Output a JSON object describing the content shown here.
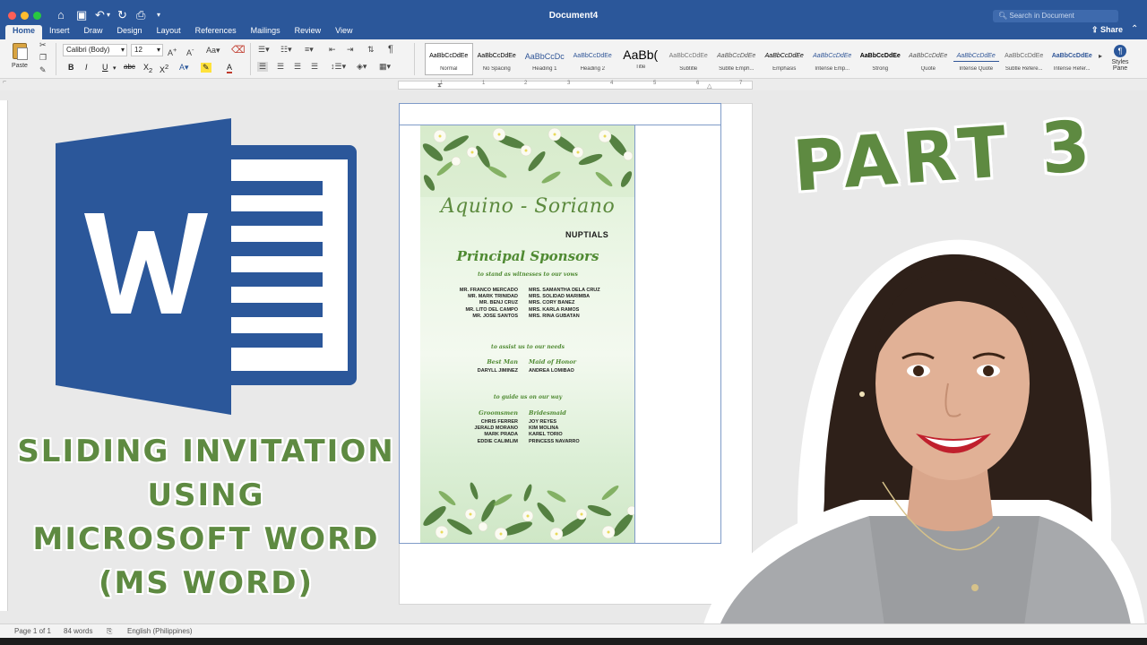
{
  "window": {
    "title": "Document4",
    "search_placeholder": "Search in Document",
    "share_label": "Share"
  },
  "tabs": [
    "Home",
    "Insert",
    "Draw",
    "Design",
    "Layout",
    "References",
    "Mailings",
    "Review",
    "View"
  ],
  "ribbon": {
    "paste_label": "Paste",
    "font_name": "Calibri (Body)",
    "font_size": "12",
    "styles": [
      {
        "sample": "AaBbCcDdEe",
        "label": "Normal"
      },
      {
        "sample": "AaBbCcDdEe",
        "label": "No Spacing"
      },
      {
        "sample": "AaBbCcDc",
        "label": "Heading 1"
      },
      {
        "sample": "AaBbCcDdEe",
        "label": "Heading 2"
      },
      {
        "sample": "AaBb(",
        "label": "Title"
      },
      {
        "sample": "AaBbCcDdEe",
        "label": "Subtitle"
      },
      {
        "sample": "AaBbCcDdEe",
        "label": "Subtle Emph..."
      },
      {
        "sample": "AaBbCcDdEe",
        "label": "Emphasis"
      },
      {
        "sample": "AaBbCcDdEe",
        "label": "Intense Emp..."
      },
      {
        "sample": "AaBbCcDdEe",
        "label": "Strong"
      },
      {
        "sample": "AaBbCcDdEe",
        "label": "Quote"
      },
      {
        "sample": "AaBbCcDdEe",
        "label": "Intense Quote"
      },
      {
        "sample": "AaBbCcDdEe",
        "label": "Subtle Refere..."
      },
      {
        "sample": "AaBbCcDdEe",
        "label": "Intense Refer..."
      }
    ],
    "styles_pane_label": "Styles Pane"
  },
  "ruler": {
    "numbers": [
      "1",
      "1",
      "2",
      "3",
      "4",
      "5",
      "6",
      "7"
    ]
  },
  "invitation": {
    "names": "Aquino  -  Soriano",
    "nuptials": "NUPTIALS",
    "heading": "Principal Sponsors",
    "sponsors_sub": "to stand as witnesses to our vows",
    "sponsors_left": [
      "MR. FRANCO MERCADO",
      "MR. MARK TRINIDAD",
      "MR. BENJ CRUZ",
      "MR. LITO DEL CAMPO",
      "MR. JOSE SANTOS"
    ],
    "sponsors_right": [
      "MRS. SAMANTHA DELA CRUZ",
      "MRS. SOLIDAD MARIMBA",
      "MRS. CORY BANEZ",
      "MRS. KARLA RAMOS",
      "MRS. RINA GUBATAN"
    ],
    "assist_sub": "to assist us to our needs",
    "best_man_label": "Best Man",
    "maid_label": "Maid of Honor",
    "best_man": "DARYLL JIMINEZ",
    "maid": "ANDREA LOMIBAO",
    "guide_sub": "to guide us on our way",
    "groomsmen_label": "Groomsmen",
    "bridesmaid_label": "Bridesmaid",
    "groomsmen": [
      "CHRIS FERRER",
      "JERALD MORANO",
      "MARK PRADA",
      "EDDIE CALIMLIM"
    ],
    "bridesmaids": [
      "JOY REYES",
      "KIM MOLINA",
      "KAREL TORIO",
      "PRINCESS NAVARRO"
    ]
  },
  "thumbnail": {
    "title_lines": [
      "SLIDING INVITATION",
      "USING",
      "MICROSOFT WORD",
      "(MS WORD)"
    ],
    "part": "PART 3"
  },
  "status": {
    "page": "Page 1 of 1",
    "words": "84 words",
    "language": "English (Philippines)"
  },
  "colors": {
    "word_blue": "#2b579a",
    "title_green": "#5e8a41",
    "invite_green": "#4f8a32"
  }
}
